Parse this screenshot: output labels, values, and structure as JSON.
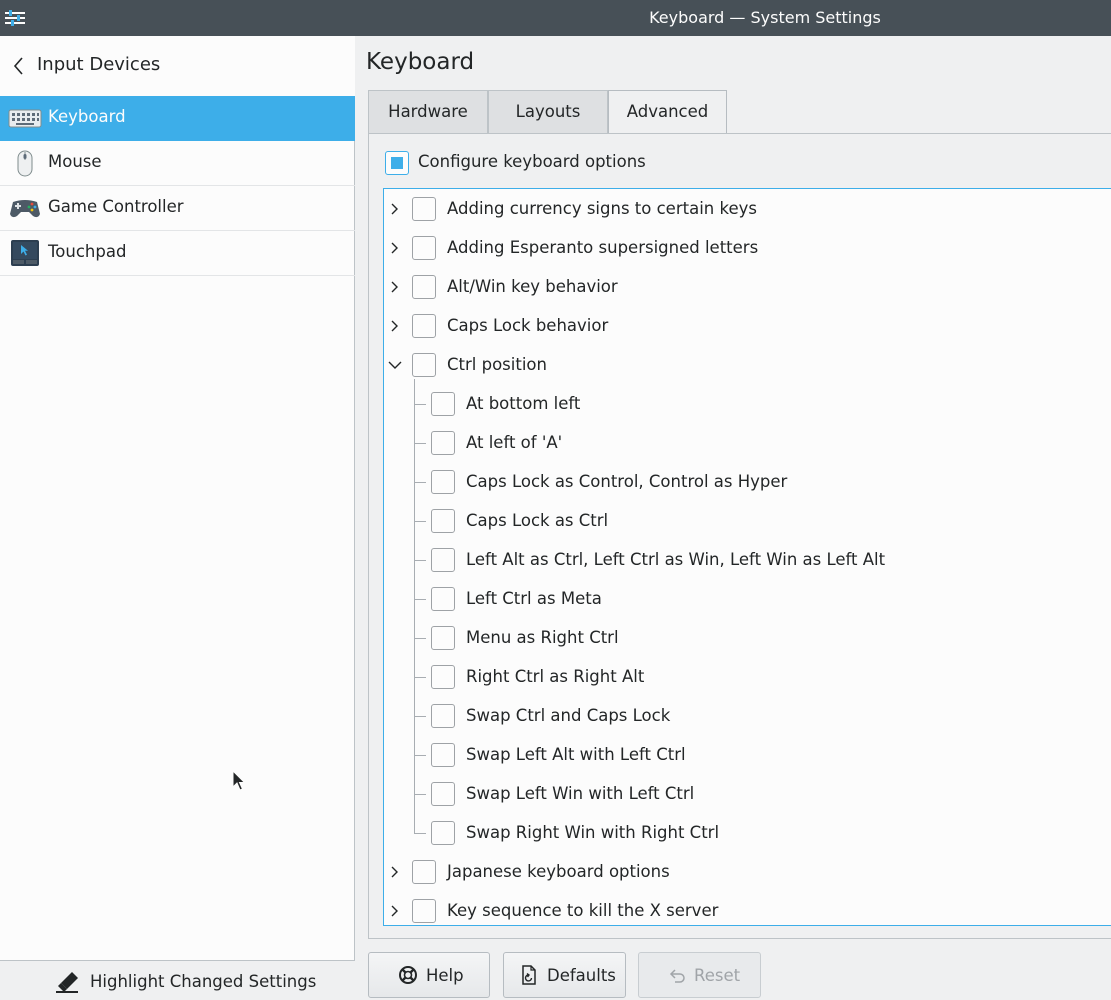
{
  "window": {
    "title": "Keyboard — System Settings"
  },
  "sidebar": {
    "back_label": "Input Devices",
    "items": [
      {
        "label": "Keyboard",
        "icon": "keyboard-icon",
        "active": true
      },
      {
        "label": "Mouse",
        "icon": "mouse-icon",
        "active": false
      },
      {
        "label": "Game Controller",
        "icon": "game-controller-icon",
        "active": false
      },
      {
        "label": "Touchpad",
        "icon": "touchpad-icon",
        "active": false
      }
    ],
    "footer_label": "Highlight Changed Settings"
  },
  "main": {
    "title": "Keyboard",
    "tabs": [
      {
        "label": "Hardware",
        "active": false
      },
      {
        "label": "Layouts",
        "active": false
      },
      {
        "label": "Advanced",
        "active": true
      }
    ],
    "configure_label": "Configure keyboard options",
    "configure_checked": true,
    "options": [
      {
        "label": "Adding currency signs to certain keys",
        "expanded": false
      },
      {
        "label": "Adding Esperanto supersigned letters",
        "expanded": false
      },
      {
        "label": "Alt/Win key behavior",
        "expanded": false
      },
      {
        "label": "Caps Lock behavior",
        "expanded": false
      },
      {
        "label": "Ctrl position",
        "expanded": true,
        "children": [
          "At bottom left",
          "At left of 'A'",
          "Caps Lock as Control, Control as Hyper",
          "Caps Lock as Ctrl",
          "Left Alt as Ctrl, Left Ctrl as Win, Left Win as Left Alt",
          "Left Ctrl as Meta",
          "Menu as Right Ctrl",
          "Right Ctrl as Right Alt",
          "Swap Ctrl and Caps Lock",
          "Swap Left Alt with Left Ctrl",
          "Swap Left Win with Left Ctrl",
          "Swap Right Win with Right Ctrl"
        ]
      },
      {
        "label": "Japanese keyboard options",
        "expanded": false
      },
      {
        "label": "Key sequence to kill the X server",
        "expanded": false
      }
    ]
  },
  "buttons": {
    "help": "Help",
    "defaults": "Defaults",
    "reset": "Reset"
  },
  "colors": {
    "accent": "#3daee9",
    "titlebar": "#475057",
    "window_bg": "#eff0f1"
  }
}
